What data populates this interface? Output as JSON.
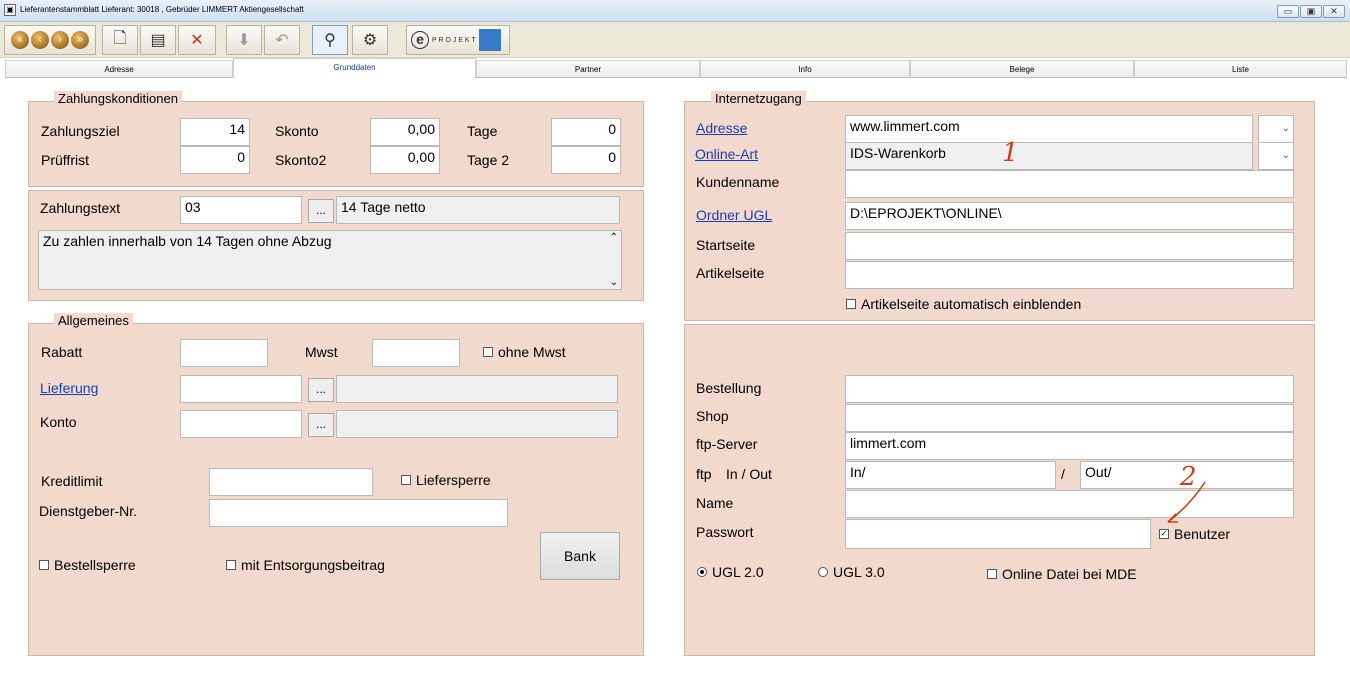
{
  "window": {
    "title": "Lieferantenstammblatt Lieferant:     30018 , Gebrüder LIMMERT Aktiengesellschaft",
    "min_glyph": "▭",
    "restore_glyph": "▣",
    "close_glyph": "✕"
  },
  "toolbar": {
    "nav_glyphs": [
      "«",
      "‹",
      "›",
      "»"
    ],
    "eprojekt_logo_text": "P R O J E K T",
    "eprojekt_e": "e"
  },
  "tabs": [
    "Adresse",
    "Grunddaten",
    "Partner",
    "Info",
    "Belege",
    "Liste"
  ],
  "active_tab": "Grunddaten",
  "zahlung": {
    "legend": "Zahlungskonditionen",
    "ziel_label": "Zahlungsziel",
    "ziel_value": "14",
    "skonto_label": "Skonto",
    "skonto_value": "0,00",
    "tage_label": "Tage",
    "tage_value": "0",
    "pruef_label": "Prüffrist",
    "pruef_value": "0",
    "skonto2_label": "Skonto2",
    "skonto2_value": "0,00",
    "tage2_label": "Tage 2",
    "tage2_value": "0",
    "text_label": "Zahlungstext",
    "text_code": "03",
    "dots": "...",
    "text_desc": "14 Tage netto",
    "text_long": "Zu zahlen innerhalb von 14 Tagen ohne Abzug"
  },
  "allgemein": {
    "legend": "Allgemeines",
    "rabatt_label": "Rabatt",
    "rabatt_value": "",
    "mwst_label": "Mwst",
    "mwst_value": "",
    "ohne_mwst": "ohne Mwst",
    "ohne_mwst_checked": false,
    "lieferung_label": "Lieferung",
    "lieferung_value": "",
    "lieferung_desc": "",
    "konto_label": "Konto",
    "konto_value": "",
    "konto_desc": "",
    "kreditlimit_label": "Kreditlimit",
    "kreditlimit_value": "",
    "liefersperre": "Liefersperre",
    "liefersperre_checked": false,
    "dienstgeber_label": "Dienstgeber-Nr.",
    "dienstgeber_value": "",
    "bestellsperre": "Bestellsperre",
    "bestellsperre_checked": false,
    "entsorgung": "mit Entsorgungsbeitrag",
    "entsorgung_checked": false,
    "bank_button": "Bank"
  },
  "internet": {
    "legend": "Internetzugang",
    "adresse_label": "Adresse",
    "adresse_value": "www.limmert.com",
    "onlineart_label": "Online-Art",
    "onlineart_value": "IDS-Warenkorb",
    "kundenname_label": "Kundenname",
    "kundenname_value": "",
    "ordner_label": "Ordner UGL",
    "ordner_value": "D:\\EPROJEKT\\ONLINE\\",
    "startseite_label": "Startseite",
    "startseite_value": "",
    "artikelseite_label": "Artikelseite",
    "artikelseite_value": "",
    "auto_label": "Artikelseite automatisch einblenden",
    "auto_checked": false
  },
  "online": {
    "bestellung_label": "Bestellung",
    "bestellung_value": "",
    "shop_label": "Shop",
    "shop_value": "",
    "ftp_label": "ftp-Server",
    "ftp_value": "limmert.com",
    "inout_label_ftp": "ftp",
    "inout_label": "In / Out",
    "in_value": "In/",
    "sep": "/",
    "out_value": "Out/",
    "name_label": "Name",
    "name_value": "",
    "passwort_label": "Passwort",
    "passwort_value": "",
    "benutzer_label": "Benutzer",
    "benutzer_checked": true,
    "ugl2": "UGL 2.0",
    "ugl3": "UGL 3.0",
    "ugl_selected": "UGL 2.0",
    "mde_label": "Online Datei bei MDE",
    "mde_checked": false
  },
  "annotations": {
    "one": "1",
    "two": "2"
  },
  "dropdown_glyph": "⌄",
  "scroll_up": "⌃",
  "scroll_down": "⌄"
}
